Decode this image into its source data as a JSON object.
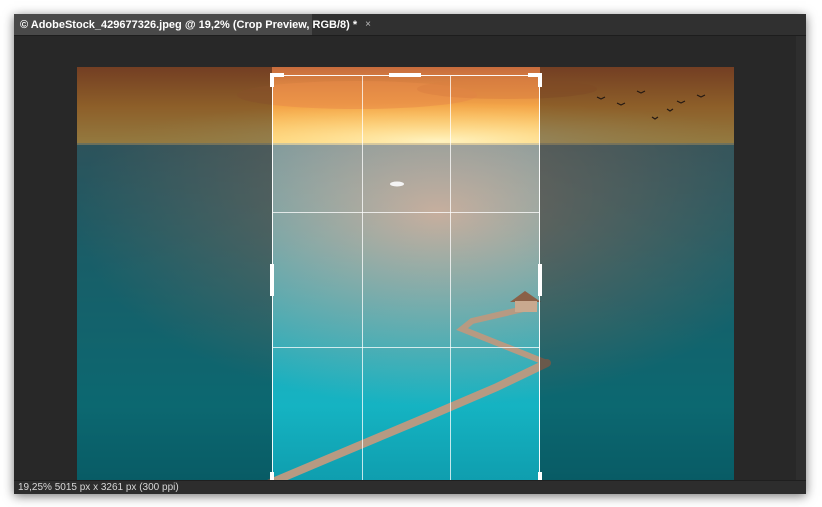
{
  "document": {
    "tab_title": "© AdobeStock_429677326.jpeg @ 19,2% (Crop Preview, RGB/8) *",
    "close_glyph": "×"
  },
  "status_bar": {
    "zoom": "19,25%",
    "doc_info": "5015 px x 3261 px (300 ppi)"
  },
  "colors": {
    "app_background": "#282828",
    "tab_active": "#494949",
    "crop_border": "#ffffff"
  },
  "icons": {
    "close": "close-icon"
  }
}
